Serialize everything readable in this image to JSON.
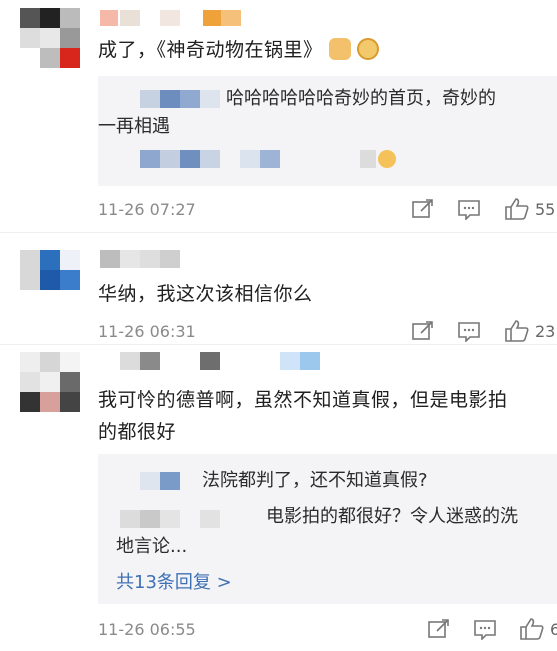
{
  "comments": [
    {
      "text": "成了，《神奇动物在锅里》",
      "time": "11-26 07:27",
      "likes": "55",
      "reply": {
        "text_line1": "哈哈哈哈哈哈奇妙的首页，奇妙的",
        "text_line2": "一再相遇"
      }
    },
    {
      "text": "华纳，我这次该相信你么",
      "time": "11-26 06:31",
      "likes": "23"
    },
    {
      "text_line1": "我可怜的德普啊，虽然不知道真假，但是电影拍",
      "text_line2": "的都很好",
      "time": "11-26 06:55",
      "likes": "6",
      "replies": [
        {
          "text": "法院都判了，还不知道真假?"
        },
        {
          "text_line1": "电影拍的都很好？令人迷惑的洗",
          "text_line2": "地言论..."
        }
      ],
      "more_replies": "共13条回复 >"
    }
  ],
  "colors": {
    "link": "#3e71b4",
    "reply_bg": "#f4f4f6",
    "meta": "#8a8a8a"
  },
  "icons": [
    "share-icon",
    "comment-icon",
    "like-icon",
    "thumbs-up-emoji",
    "doge-emoji",
    "grin-emoji"
  ]
}
